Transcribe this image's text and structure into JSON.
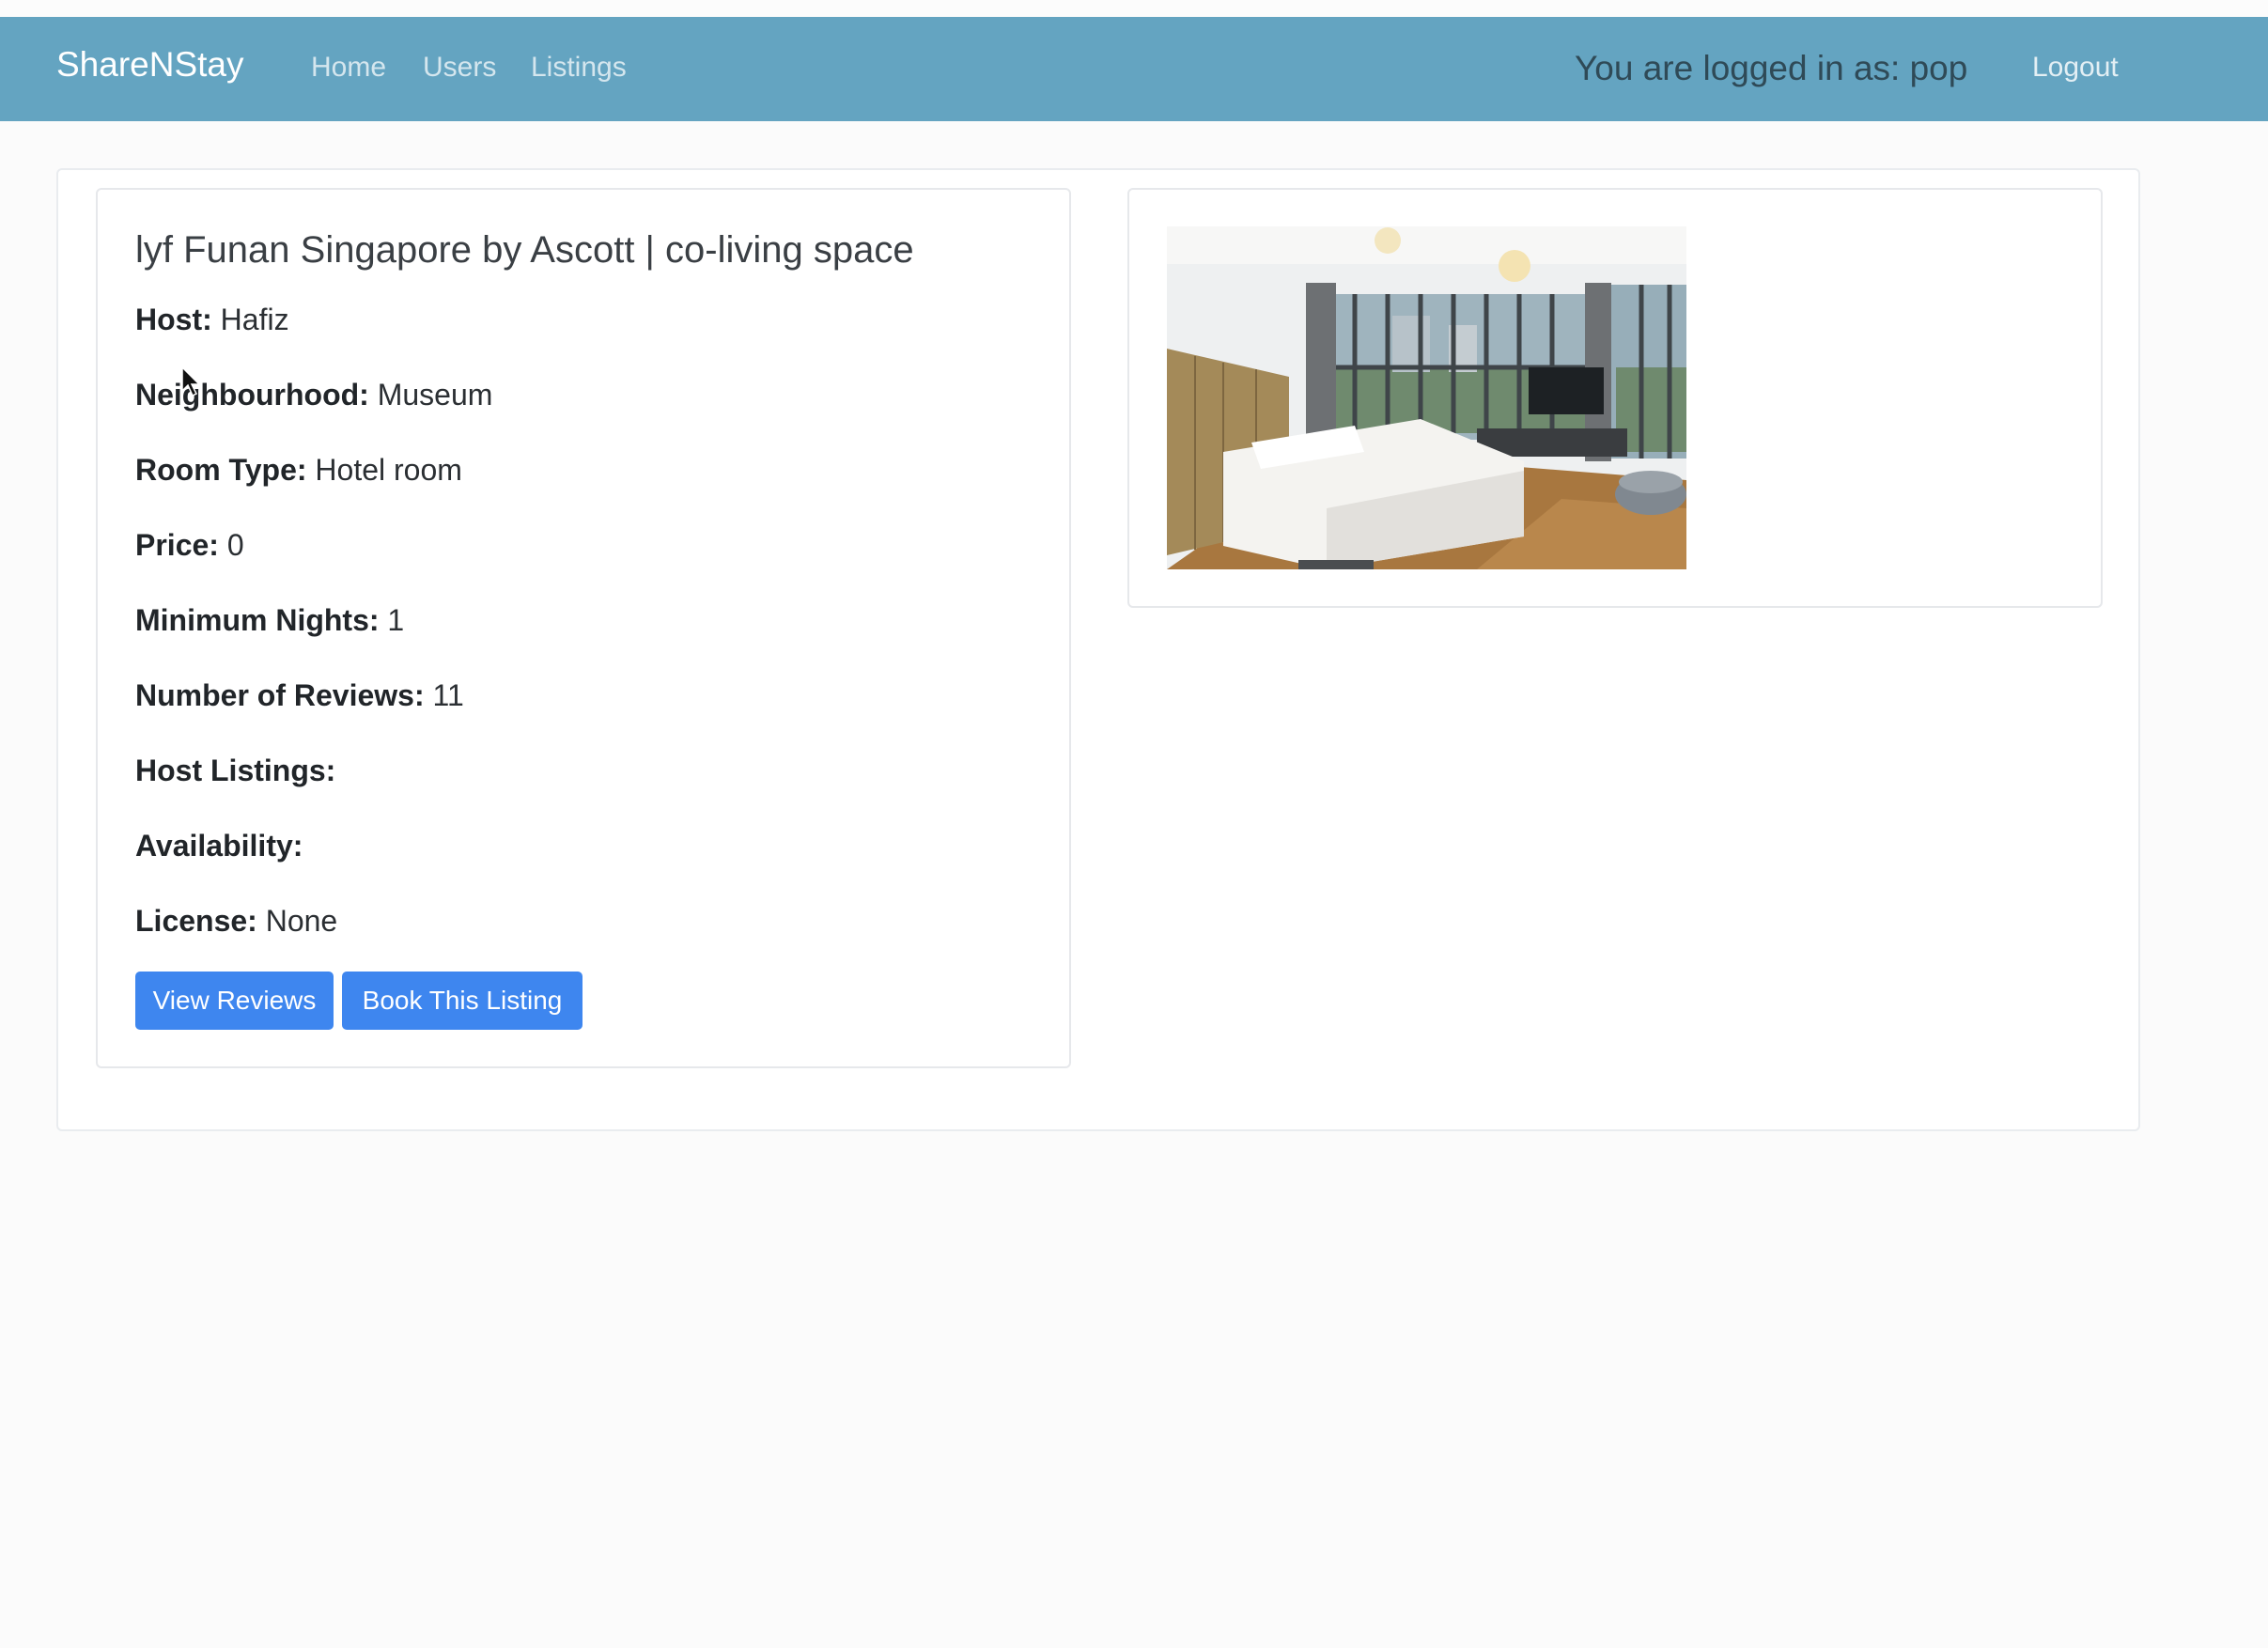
{
  "navbar": {
    "brand": "ShareNStay",
    "links": [
      "Home",
      "Users",
      "Listings"
    ],
    "logged_in_text": "You are logged in as: pop",
    "logout_label": "Logout"
  },
  "listing": {
    "title": "lyf Funan Singapore by Ascott | co-living space",
    "fields": [
      {
        "label": "Host:",
        "value": "Hafiz"
      },
      {
        "label": "Neighbourhood:",
        "value": "Museum"
      },
      {
        "label": "Room Type:",
        "value": "Hotel room"
      },
      {
        "label": "Price:",
        "value": "0"
      },
      {
        "label": "Minimum Nights:",
        "value": "1"
      },
      {
        "label": "Number of Reviews:",
        "value": "11"
      },
      {
        "label": "Host Listings:",
        "value": ""
      },
      {
        "label": "Availability:",
        "value": ""
      },
      {
        "label": "License:",
        "value": "None"
      }
    ],
    "buttons": {
      "view_reviews": "View Reviews",
      "book": "Book This Listing"
    }
  },
  "colors": {
    "navbar": "#64a4c1",
    "button": "#3e86ef"
  }
}
